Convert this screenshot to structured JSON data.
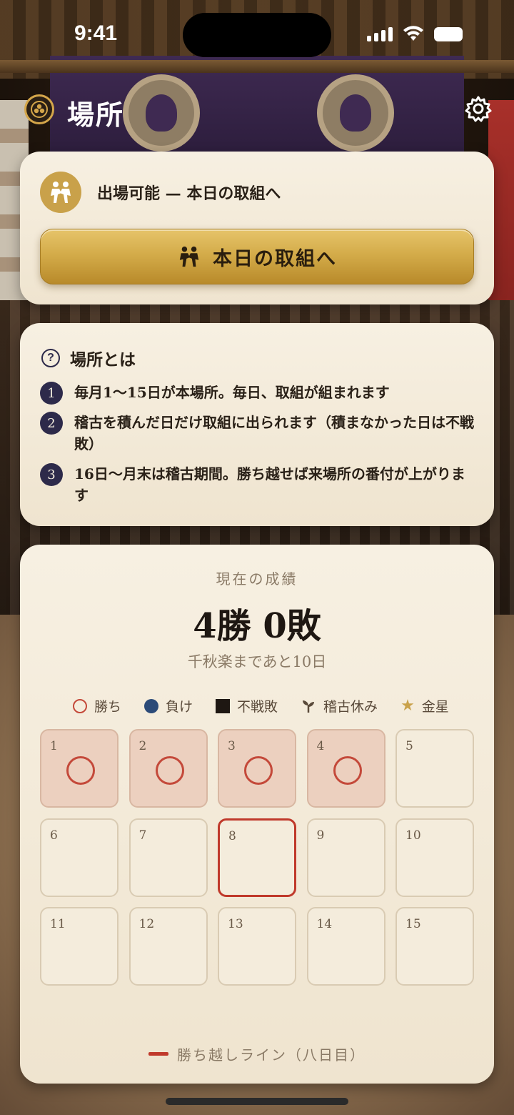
{
  "status_bar": {
    "time": "9:41"
  },
  "header": {
    "title": "場所"
  },
  "entry_card": {
    "status_text": "出場可能 — 本日の取組へ",
    "button_label": "本日の取組へ"
  },
  "info_card": {
    "title": "場所とは",
    "rules": [
      {
        "num": "1",
        "text": "毎月1〜15日が本場所。毎日、取組が組まれます"
      },
      {
        "num": "2",
        "text": "稽古を積んだ日だけ取組に出られます（積まなかった日は不戦敗）"
      },
      {
        "num": "3",
        "text": "16日〜月末は稽古期間。勝ち越せば来場所の番付が上がります"
      }
    ]
  },
  "record_card": {
    "label": "現在の成績",
    "score": "4勝 0敗",
    "remaining": "千秋楽まであと10日",
    "legend": {
      "win": "勝ち",
      "loss": "負け",
      "fusen": "不戦敗",
      "rest": "稽古休み",
      "kinboshi": "金星"
    },
    "days": [
      {
        "day": "1",
        "result": "win"
      },
      {
        "day": "2",
        "result": "win"
      },
      {
        "day": "3",
        "result": "win"
      },
      {
        "day": "4",
        "result": "win"
      },
      {
        "day": "5",
        "result": "none"
      },
      {
        "day": "6",
        "result": "none"
      },
      {
        "day": "7",
        "result": "none"
      },
      {
        "day": "8",
        "result": "today"
      },
      {
        "day": "9",
        "result": "none"
      },
      {
        "day": "10",
        "result": "none"
      },
      {
        "day": "11",
        "result": "none"
      },
      {
        "day": "12",
        "result": "none"
      },
      {
        "day": "13",
        "result": "none"
      },
      {
        "day": "14",
        "result": "none"
      },
      {
        "day": "15",
        "result": "none"
      }
    ],
    "kachikoshi_label": "勝ち越しライン（八日目）"
  },
  "colors": {
    "accent_gold": "#d4ac4a",
    "win_red": "#c4493a",
    "loss_blue": "#2b4a78",
    "today_border": "#c0392b",
    "navy": "#2d2a4a"
  }
}
